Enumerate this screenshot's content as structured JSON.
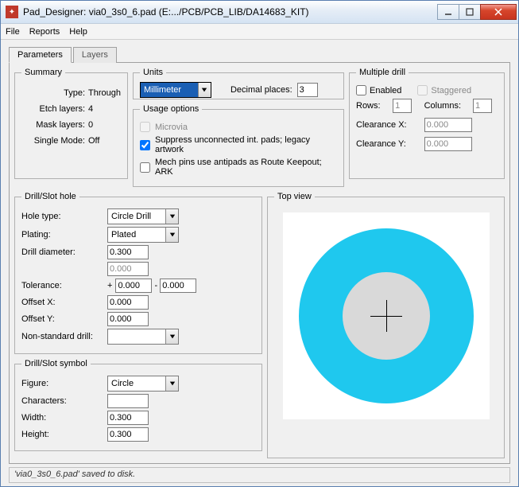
{
  "window": {
    "title": "Pad_Designer: via0_3s0_6.pad (E:.../PCB/PCB_LIB/DA14683_KIT)"
  },
  "menu": {
    "file": "File",
    "reports": "Reports",
    "help": "Help"
  },
  "tabs": {
    "parameters": "Parameters",
    "layers": "Layers"
  },
  "summary": {
    "legend": "Summary",
    "type_label": "Type:",
    "type_value": "Through",
    "etch_label": "Etch layers:",
    "etch_value": "4",
    "mask_label": "Mask layers:",
    "mask_value": "0",
    "single_label": "Single Mode:",
    "single_value": "Off"
  },
  "units": {
    "legend": "Units",
    "unit_value": "Millimeter",
    "dp_label": "Decimal places:",
    "dp_value": "3"
  },
  "usage": {
    "legend": "Usage options",
    "microvia": "Microvia",
    "suppress": "Suppress unconnected int. pads; legacy artwork",
    "mech": "Mech pins use antipads as Route Keepout; ARK"
  },
  "multi": {
    "legend": "Multiple drill",
    "enabled": "Enabled",
    "staggered": "Staggered",
    "rows_label": "Rows:",
    "rows_value": "1",
    "cols_label": "Columns:",
    "cols_value": "1",
    "clx_label": "Clearance X:",
    "clx_value": "0.000",
    "cly_label": "Clearance Y:",
    "cly_value": "0.000"
  },
  "drillhole": {
    "legend": "Drill/Slot hole",
    "holetype_label": "Hole type:",
    "holetype_value": "Circle Drill",
    "plating_label": "Plating:",
    "plating_value": "Plated",
    "diam_label": "Drill diameter:",
    "diam_value": "0.300",
    "diam2_value": "0.000",
    "tol_label": "Tolerance:",
    "tol_plus": "+",
    "tol_a": "0.000",
    "tol_sep": "-",
    "tol_b": "0.000",
    "offx_label": "Offset X:",
    "offx_value": "0.000",
    "offy_label": "Offset Y:",
    "offy_value": "0.000",
    "nonstd_label": "Non-standard drill:",
    "nonstd_value": ""
  },
  "drillsymbol": {
    "legend": "Drill/Slot symbol",
    "figure_label": "Figure:",
    "figure_value": "Circle",
    "chars_label": "Characters:",
    "chars_value": "",
    "width_label": "Width:",
    "width_value": "0.300",
    "height_label": "Height:",
    "height_value": "0.300"
  },
  "topview": {
    "legend": "Top view"
  },
  "status": "'via0_3s0_6.pad' saved to disk."
}
